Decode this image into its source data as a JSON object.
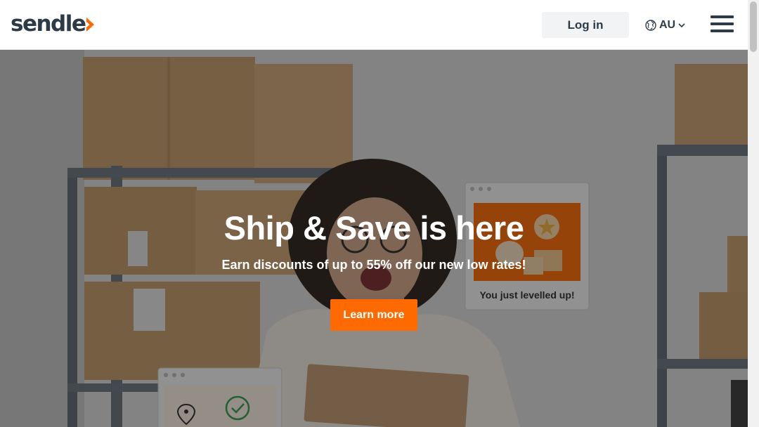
{
  "brand": {
    "logo_text": "sendle",
    "accent_color": "#ff6a00",
    "text_color": "#2d3b48"
  },
  "header": {
    "login_label": "Log in",
    "locale": {
      "label": "AU",
      "icon": "globe-icon"
    },
    "menu_icon": "hamburger-icon"
  },
  "hero": {
    "title": "Ship & Save is here",
    "subtitle": "Earn discounts of up to 55% off our new low rates!",
    "cta_label": "Learn more",
    "card_caption": "You just levelled up!"
  }
}
